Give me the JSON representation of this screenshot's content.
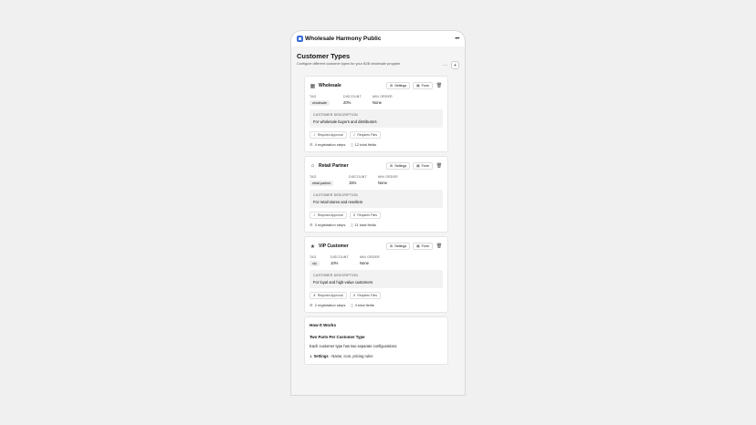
{
  "app": {
    "title": "Wholesale Harmony Public"
  },
  "page": {
    "title": "Customer Types",
    "subtitle": "Configure different customer types for your B2B wholesale program"
  },
  "labels": {
    "settings": "Settings",
    "form": "Form",
    "tag": "TAG",
    "discount": "DISCOUNT",
    "min_order": "MIN ORDER",
    "customer_description": "CUSTOMER DESCRIPTION",
    "requires_approval": "Requires Approval",
    "requires_files": "Requires Files"
  },
  "types": [
    {
      "name": "Wholesale",
      "icon": "building-icon",
      "tag": "wholesale",
      "discount": "20%",
      "min_order": "None",
      "description": "For wholesale buyers and distributors",
      "approval_mark": "✓",
      "files_mark": "✓",
      "steps": "4 registration steps",
      "fields": "12 total fields"
    },
    {
      "name": "Retail Partner",
      "icon": "store-icon",
      "tag": "retail-partner",
      "discount": "15%",
      "min_order": "None",
      "description": "For retail stores and resellers",
      "approval_mark": "✓",
      "files_mark": "✗",
      "steps": "3 registration steps",
      "fields": "11 total fields"
    },
    {
      "name": "VIP Customer",
      "icon": "star-icon",
      "tag": "vip",
      "discount": "10%",
      "min_order": "None",
      "description": "For loyal and high-value customers",
      "approval_mark": "✗",
      "files_mark": "✗",
      "steps": "2 registration steps",
      "fields": "4 total fields"
    }
  ],
  "how": {
    "title": "How It Works",
    "subtitle": "Two Parts Per Customer Type",
    "text": "Each customer type has two separate configurations:",
    "item_prefix": "1. ",
    "item_bold": "Settings",
    "item_rest": " - Name, icon, pricing rules"
  }
}
